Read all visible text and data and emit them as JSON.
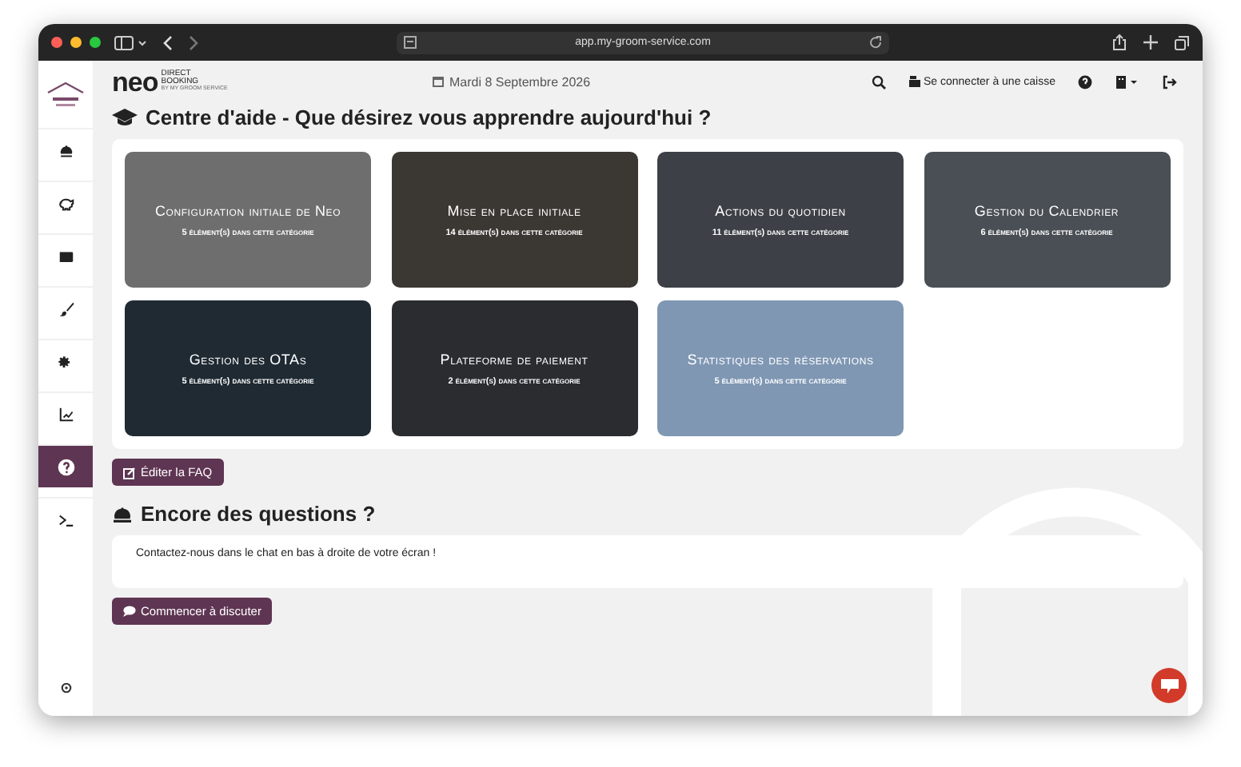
{
  "browser": {
    "url": "app.my-groom-service.com"
  },
  "sidebar": {
    "items": [
      {
        "kind": "bell",
        "selected": false
      },
      {
        "kind": "piggy",
        "selected": false
      },
      {
        "kind": "wallet",
        "selected": false
      },
      {
        "kind": "brush",
        "selected": false
      },
      {
        "kind": "gears",
        "selected": false
      },
      {
        "kind": "chart",
        "selected": false
      },
      {
        "kind": "help",
        "selected": true
      },
      {
        "kind": "terminal",
        "selected": false
      }
    ]
  },
  "header": {
    "logo": {
      "name": "neo",
      "badge_1": "DIRECT",
      "badge_2": "BOOKING",
      "tagline": "BY MY GROOM SERVICE"
    },
    "date": "Mardi 8 Septembre 2026",
    "cash_register": "Se connecter à une caisse"
  },
  "title": "Centre d'aide - Que désirez vous apprendre aujourd'hui ?",
  "categories": [
    {
      "title": "Configuration initiale de Neo",
      "count": "5 élément(s) dans cette catégorie"
    },
    {
      "title": "Mise en place initiale",
      "count": "14 élément(s) dans cette catégorie"
    },
    {
      "title": "Actions du quotidien",
      "count": "11 élément(s) dans cette catégorie"
    },
    {
      "title": "Gestion du Calendrier",
      "count": "6 élément(s) dans cette catégorie"
    },
    {
      "title": "Gestion des OTAs",
      "count": "5 élément(s) dans cette catégorie"
    },
    {
      "title": "Plateforme de paiement",
      "count": "2 élément(s) dans cette catégorie"
    },
    {
      "title": "Statistiques des réservations",
      "count": "5 élément(s) dans cette catégorie"
    }
  ],
  "edit_button": "Éditer la FAQ",
  "questions": {
    "title": "Encore des questions ?",
    "message": "Contactez-nous dans le chat en bas à droite de votre écran !",
    "button": "Commencer à discuter"
  }
}
